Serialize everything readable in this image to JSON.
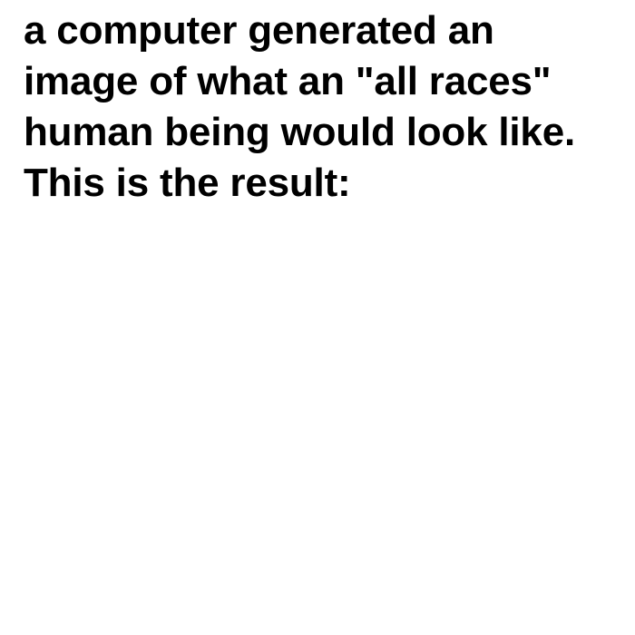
{
  "caption": {
    "lines": [
      "a computer generated an",
      "image of what an \"all races\"",
      "human being would look like.",
      "This is the result:"
    ]
  },
  "colors": {
    "background": "#ffffff",
    "text": "#000000"
  }
}
